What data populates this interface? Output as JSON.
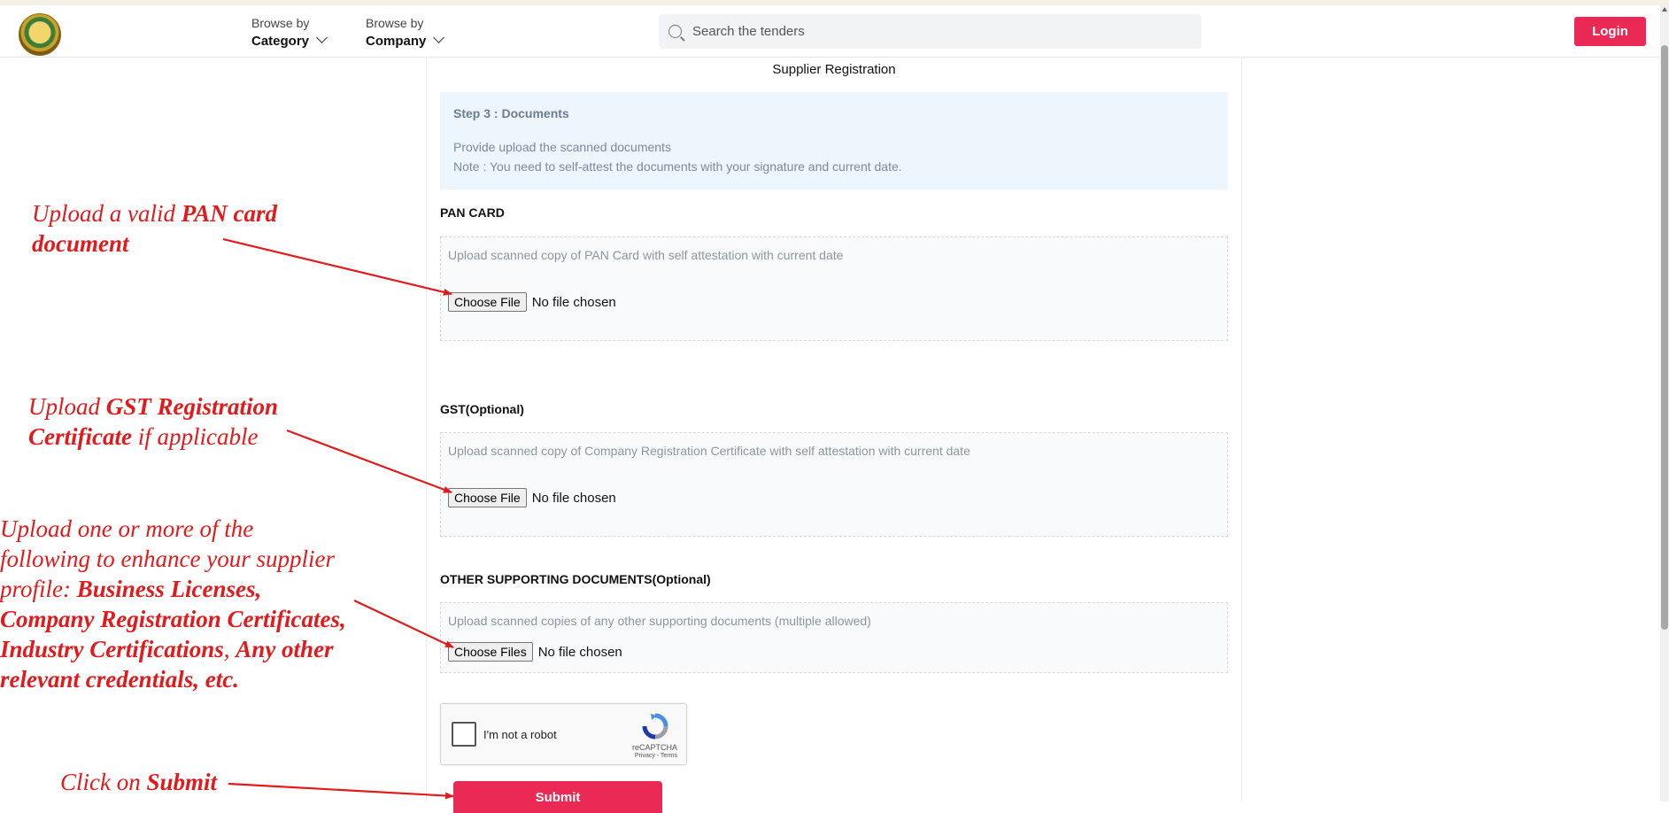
{
  "header": {
    "browse_category": {
      "small": "Browse by",
      "big": "Category"
    },
    "browse_company": {
      "small": "Browse by",
      "big": "Company"
    },
    "search_placeholder": "Search the tenders",
    "login_label": "Login"
  },
  "form": {
    "title": "Supplier Registration",
    "step": {
      "heading": "Step 3 : Documents",
      "line1": "Provide upload the scanned documents",
      "line2": "Note : You need to self-attest the documents with your signature and current date."
    },
    "pan": {
      "label": "PAN CARD",
      "hint": "Upload scanned copy of PAN Card with self attestation with current date",
      "button": "Choose File",
      "status": "No file chosen"
    },
    "gst": {
      "label": "GST(Optional)",
      "hint": "Upload scanned copy of Company Registration Certificate with self attestation with current date",
      "button": "Choose File",
      "status": "No file chosen"
    },
    "other": {
      "label": "OTHER SUPPORTING DOCUMENTS(Optional)",
      "hint": "Upload scanned copies of any other supporting documents (multiple allowed)",
      "button": "Choose Files",
      "status": "No file chosen"
    },
    "recaptcha": {
      "label": "I'm not a robot",
      "brand": "reCAPTCHA",
      "terms": "Privacy - Terms"
    },
    "submit_label": "Submit"
  },
  "annotations": {
    "pan": {
      "a": "Upload a valid ",
      "b": "PAN card",
      "c": "document"
    },
    "gst": {
      "a": "Upload ",
      "b": "GST Registration",
      "c": "Certificate",
      "d": " if applicable"
    },
    "other": {
      "l1": "Upload one or more of the",
      "l2": "following to enhance your supplier",
      "l3a": "profile: ",
      "l3b": "Business Licenses,",
      "l4": "Company Registration Certificates,",
      "l5a": "Industry Certifications",
      "l5b": ", ",
      "l5c": "Any other",
      "l6": "relevant credentials, etc."
    },
    "submit": {
      "a": "Click on ",
      "b": "Submit"
    }
  },
  "colors": {
    "accent": "#ea2a55",
    "annotation": "#e31a1c"
  }
}
